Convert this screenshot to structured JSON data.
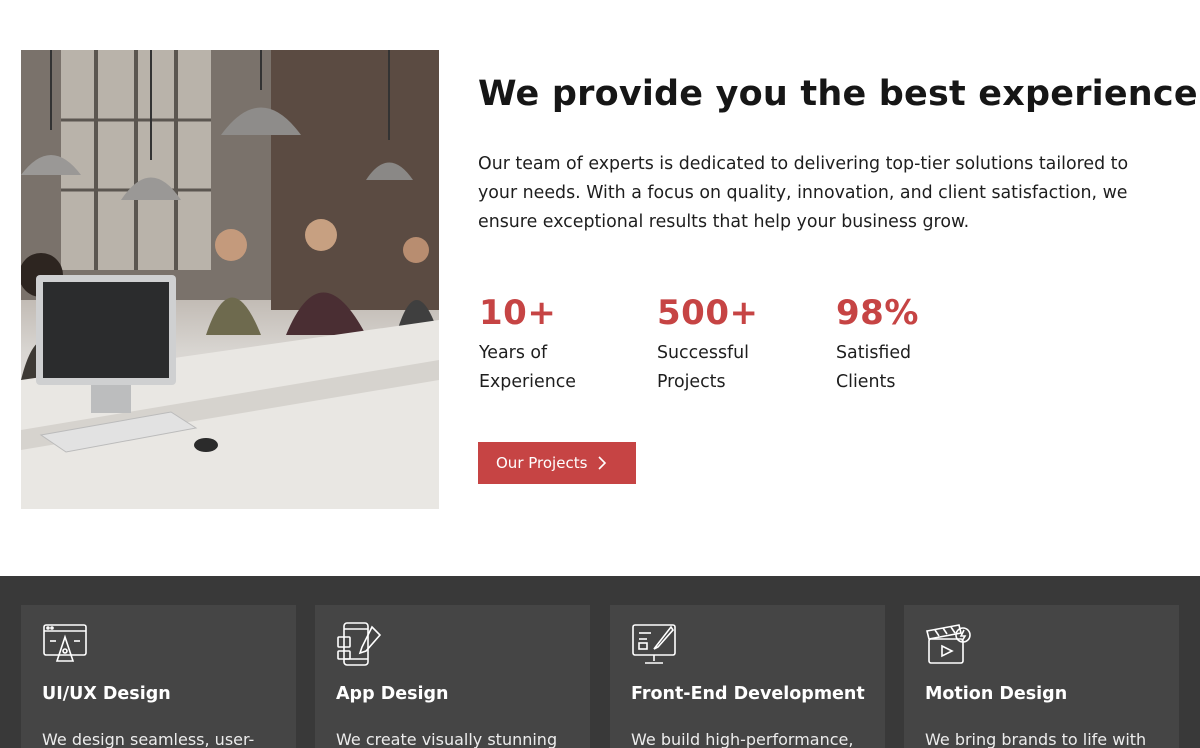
{
  "about": {
    "image_subject": "office-team-photo",
    "headline": "We provide you the best experience",
    "intro": "Our team of experts is dedicated to delivering top-tier solutions tailored to your needs. With a focus on quality, innovation, and client satisfaction, we ensure exceptional results that help your business grow.",
    "stats": [
      {
        "value": "10+",
        "label_line1": "Years of",
        "label_line2": "Experience"
      },
      {
        "value": "500+",
        "label_line1": "Successful",
        "label_line2": "Projects"
      },
      {
        "value": "98%",
        "label_line1": "Satisfied",
        "label_line2": "Clients"
      }
    ],
    "cta_label": "Our Projects",
    "cta_icon": "chevron-right-icon"
  },
  "services": [
    {
      "icon": "ui-ux-design-icon",
      "title": "UI/UX Design",
      "desc": "We design seamless, user-"
    },
    {
      "icon": "app-design-icon",
      "title": "App Design",
      "desc": "We create visually stunning"
    },
    {
      "icon": "front-end-development-icon",
      "title": "Front-End Development",
      "desc": "We build high-performance,"
    },
    {
      "icon": "motion-design-icon",
      "title": "Motion Design",
      "desc": "We bring brands to life with"
    }
  ],
  "colors": {
    "accent": "#c64444",
    "band_bg": "#393939",
    "card_bg": "#454545"
  }
}
